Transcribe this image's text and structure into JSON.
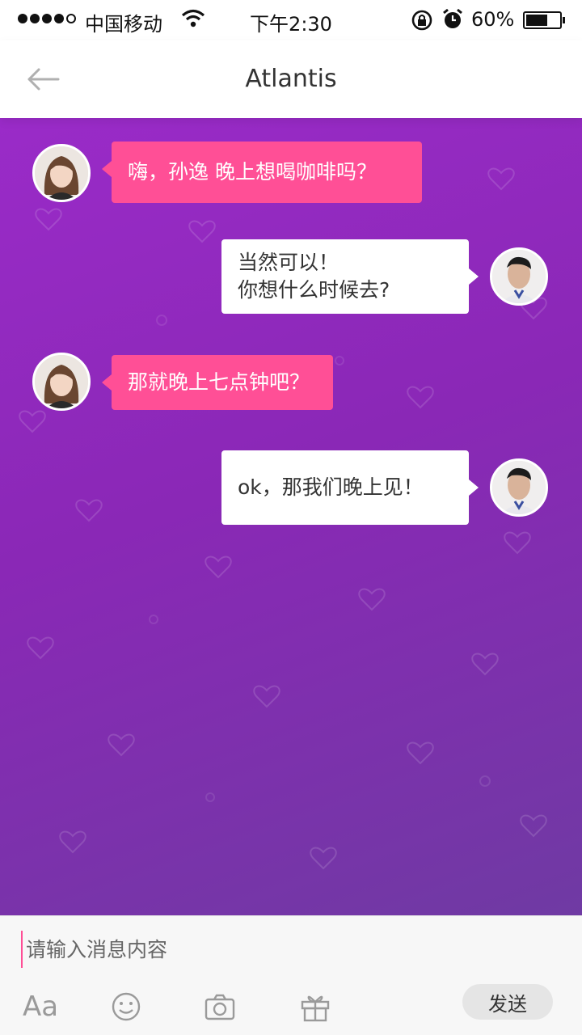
{
  "status_bar": {
    "carrier": "中国移动",
    "time": "下午2:30",
    "battery_percent": "60%",
    "battery_level": 0.6
  },
  "nav": {
    "title": "Atlantis",
    "back_icon": "arrow-left-icon"
  },
  "messages": [
    {
      "side": "left",
      "sender": "female",
      "lines": [
        "嗨，孙逸 晚上想喝咖啡吗？"
      ]
    },
    {
      "side": "right",
      "sender": "male",
      "lines": [
        "当然可以！",
        "你想什么时候去?"
      ]
    },
    {
      "side": "left",
      "sender": "female",
      "lines": [
        "那就晚上七点钟吧？"
      ]
    },
    {
      "side": "right",
      "sender": "male",
      "lines": [
        "ok，那我们晚上见！"
      ]
    }
  ],
  "input": {
    "placeholder": "请输入消息内容",
    "value": ""
  },
  "toolbar": {
    "font_label": "Aa",
    "emoji_icon": "smiley-icon",
    "camera_icon": "camera-icon",
    "gift_icon": "gift-icon",
    "send_label": "发送"
  },
  "colors": {
    "accent_pink": "#ff4f96",
    "chat_bg_top": "#9a2bc8",
    "chat_bg_bottom": "#6f3aa3"
  }
}
